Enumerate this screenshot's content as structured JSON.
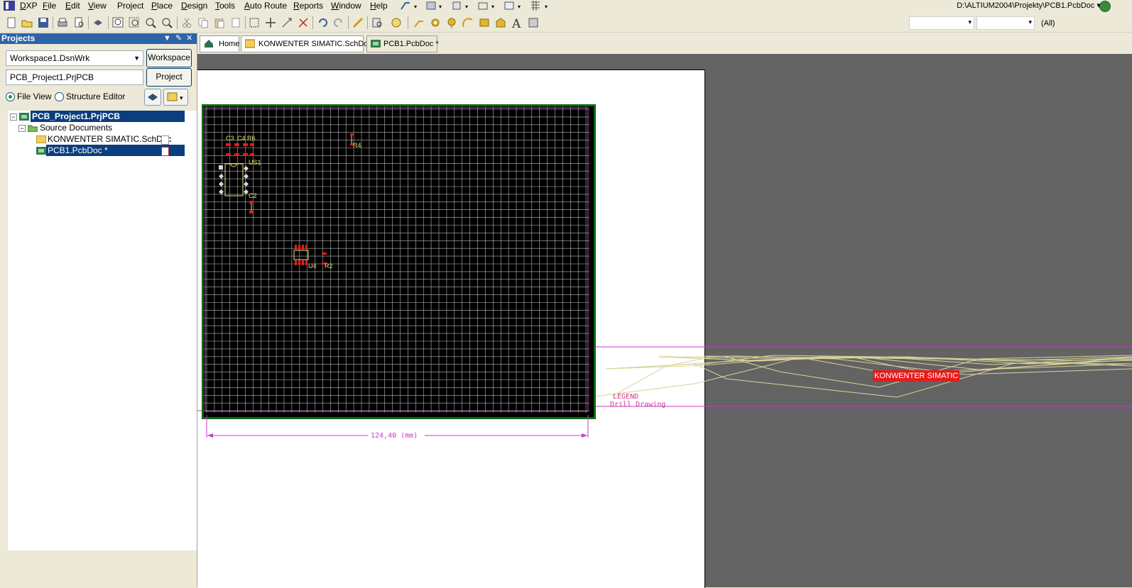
{
  "menubar": {
    "items": [
      {
        "label": "DXP",
        "key": "D"
      },
      {
        "label": "File",
        "key": "F"
      },
      {
        "label": "Edit",
        "key": "E"
      },
      {
        "label": "View",
        "key": "V"
      },
      {
        "label": "Project",
        "key": "C"
      },
      {
        "label": "Place",
        "key": "P"
      },
      {
        "label": "Design",
        "key": "D"
      },
      {
        "label": "Tools",
        "key": "T"
      },
      {
        "label": "Auto Route",
        "key": "A"
      },
      {
        "label": "Reports",
        "key": "R"
      },
      {
        "label": "Window",
        "key": "W"
      },
      {
        "label": "Help",
        "key": "H"
      }
    ],
    "path": "D:\\ALTIUM2004\\Projekty\\PCB1.PcbDoc ▾"
  },
  "toolbar": {
    "layer_filter": "(All)"
  },
  "panel": {
    "title": "Projects",
    "workspace_value": "Workspace1.DsnWrk",
    "workspace_button": "Workspace",
    "project_value": "PCB_Project1.PrjPCB",
    "project_button": "Project",
    "radio_file_view": "File View",
    "radio_structure_editor": "Structure Editor"
  },
  "tree": {
    "project": "PCB_Project1.PrjPCB",
    "folder": "Source Documents",
    "schdoc": "KONWENTER SIMATIC.SchDoc",
    "pcbdoc": "PCB1.PcbDoc *"
  },
  "tabs": [
    {
      "label": "Home"
    },
    {
      "label": "KONWENTER SIMATIC.SchDoc"
    },
    {
      "label": "PCB1.PcbDoc *"
    }
  ],
  "pcb": {
    "component_labels": {
      "c3": "C3",
      "c4": "C4",
      "r6": "R6",
      "r4": "R4",
      "us1": "US1",
      "c2": "C2",
      "u4": "U4",
      "r2": "R2"
    },
    "room_label": "KONWENTER SIMATIC",
    "legend_line1": "LEGEND",
    "legend_line2": "Drill Drawing",
    "dimension_label": "124,40 (mm)"
  },
  "colors": {
    "board_outline": "#0e6b0e",
    "grid": "#b8b8b8",
    "pads": "#e41b1b",
    "silkscreen": "#e8e27a",
    "mechanical": "#c93ac9",
    "panel_title": "#2d63a8"
  }
}
